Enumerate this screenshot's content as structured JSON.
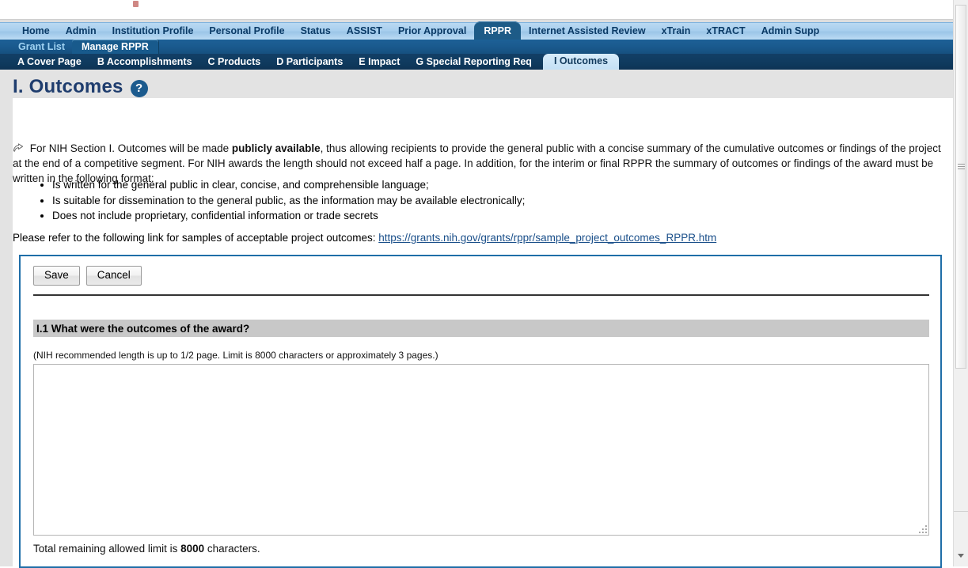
{
  "nav_primary": {
    "items": [
      {
        "label": "Home",
        "active": false
      },
      {
        "label": "Admin",
        "active": false
      },
      {
        "label": "Institution Profile",
        "active": false
      },
      {
        "label": "Personal Profile",
        "active": false
      },
      {
        "label": "Status",
        "active": false
      },
      {
        "label": "ASSIST",
        "active": false
      },
      {
        "label": "Prior Approval",
        "active": false
      },
      {
        "label": "RPPR",
        "active": true
      },
      {
        "label": "Internet Assisted Review",
        "active": false
      },
      {
        "label": "xTrain",
        "active": false
      },
      {
        "label": "xTRACT",
        "active": false
      },
      {
        "label": "Admin Supp",
        "active": false
      }
    ]
  },
  "nav_secondary": {
    "items": [
      {
        "label": "Grant List",
        "active": false
      },
      {
        "label": "Manage RPPR",
        "active": true
      }
    ]
  },
  "nav_tertiary": {
    "items": [
      {
        "label": "A Cover Page",
        "active": false
      },
      {
        "label": "B Accomplishments",
        "active": false
      },
      {
        "label": "C Products",
        "active": false
      },
      {
        "label": "D Participants",
        "active": false
      },
      {
        "label": "E Impact",
        "active": false
      },
      {
        "label": "G Special Reporting Req",
        "active": false
      },
      {
        "label": "I Outcomes",
        "active": true
      }
    ]
  },
  "header": {
    "title": "I. Outcomes",
    "help_icon": "question-mark-icon",
    "help_label": "?"
  },
  "intro": {
    "icon": "pencil-note-icon",
    "part1": "For NIH Section I. Outcomes will be made ",
    "emphasis": "publicly available",
    "part2": ", thus allowing recipients to provide the general public with a concise summary of the cumulative outcomes or findings of the project at the end of a competitive segment.  For NIH awards the length should not exceed half a page. In addition, for the interim or final RPPR the summary of outcomes or findings of the award must be written in the following format:",
    "bullets": [
      "Is written for the general public in clear, concise, and comprehensible language;",
      "Is suitable for dissemination to the general public, as the information may be available electronically;",
      "Does not include proprietary, confidential information or trade secrets"
    ],
    "link_prefix": "Please refer to the following link for samples of acceptable project outcomes: ",
    "link_text": "https://grants.nih.gov/grants/rppr/sample_project_outcomes_RPPR.htm"
  },
  "form": {
    "save_label": "Save",
    "cancel_label": "Cancel",
    "question_label": "I.1 What were the outcomes of the award?",
    "hint": "(NIH recommended length is up to 1/2 page. Limit is 8000 characters or approximately 3 pages.)",
    "textarea_value": "",
    "textarea_placeholder": "",
    "remaining_prefix": "Total remaining allowed limit is ",
    "remaining_count": "8000",
    "remaining_suffix": " characters."
  },
  "colors": {
    "accent_blue": "#1f6ea8",
    "title_blue": "#1f3d6e",
    "nav_dark": "#0f3a5e",
    "nav_light": "#a9cfee",
    "question_bar": "#c8c8c8"
  }
}
